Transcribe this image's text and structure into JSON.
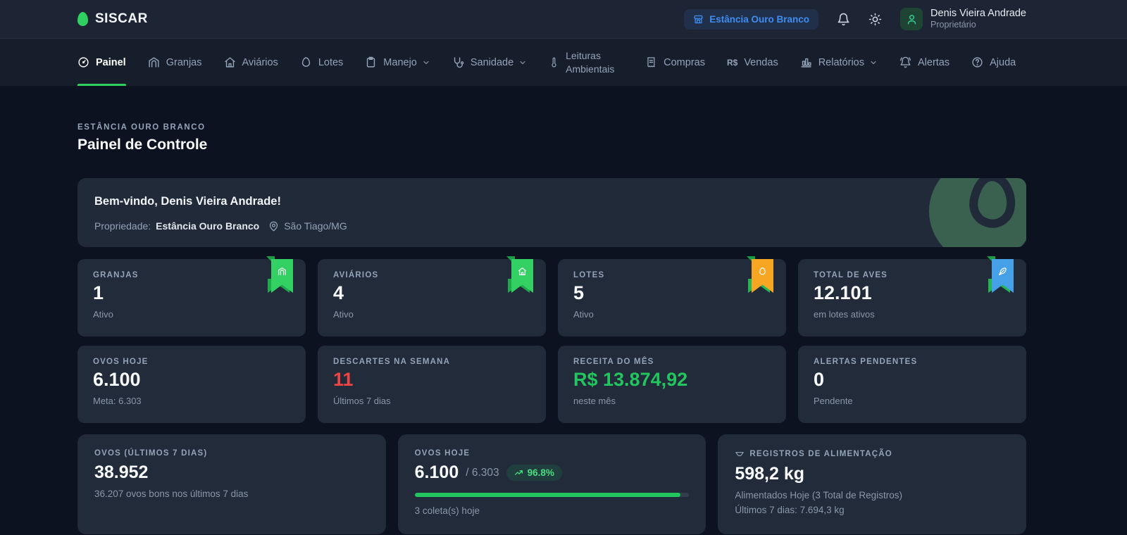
{
  "brand": {
    "name": "SISCAR"
  },
  "topbar": {
    "property_badge": "Estância Ouro Branco",
    "user": {
      "name": "Denis Vieira Andrade",
      "role": "Proprietário"
    }
  },
  "nav": {
    "items": [
      {
        "label": "Painel",
        "icon": "gauge-icon",
        "active": true
      },
      {
        "label": "Granjas",
        "icon": "warehouse-icon"
      },
      {
        "label": "Aviários",
        "icon": "home-icon"
      },
      {
        "label": "Lotes",
        "icon": "egg-icon"
      },
      {
        "label": "Manejo",
        "icon": "clipboard-icon",
        "dropdown": true
      },
      {
        "label": "Sanidade",
        "icon": "stethoscope-icon",
        "dropdown": true
      },
      {
        "label": "Leituras Ambientais",
        "icon": "thermometer-icon"
      },
      {
        "label": "Compras",
        "icon": "receipt-icon"
      },
      {
        "label": "Vendas",
        "icon": "currency-rs-icon"
      },
      {
        "label": "Relatórios",
        "icon": "bar-chart-icon",
        "dropdown": true
      },
      {
        "label": "Alertas",
        "icon": "bell-ring-icon"
      },
      {
        "label": "Ajuda",
        "icon": "help-circle-icon"
      }
    ]
  },
  "page": {
    "eyebrow": "ESTÂNCIA OURO BRANCO",
    "title": "Painel de Controle"
  },
  "welcome": {
    "greeting": "Bem-vindo, Denis Vieira Andrade!",
    "property_label": "Propriedade:",
    "property_name": "Estância Ouro Branco",
    "location": "São Tiago/MG"
  },
  "stats_row1": [
    {
      "label": "GRANJAS",
      "value": "1",
      "sub": "Ativo",
      "ribbon": "green",
      "icon": "warehouse-icon"
    },
    {
      "label": "AVIÁRIOS",
      "value": "4",
      "sub": "Ativo",
      "ribbon": "green",
      "icon": "home-icon"
    },
    {
      "label": "LOTES",
      "value": "5",
      "sub": "Ativo",
      "ribbon": "orange",
      "icon": "egg-icon"
    },
    {
      "label": "TOTAL DE AVES",
      "value": "12.101",
      "sub": "em lotes ativos",
      "ribbon": "blue",
      "icon": "feather-icon"
    }
  ],
  "stats_row2": [
    {
      "label": "OVOS HOJE",
      "value": "6.100",
      "sub": "Meta: 6.303"
    },
    {
      "label": "DESCARTES NA SEMANA",
      "value": "11",
      "sub": "Últimos 7 dias",
      "color": "red"
    },
    {
      "label": "RECEITA DO MÊS",
      "value": "R$ 13.874,92",
      "sub": "neste mês",
      "color": "green"
    },
    {
      "label": "ALERTAS PENDENTES",
      "value": "0",
      "sub": "Pendente"
    }
  ],
  "summary_cards": {
    "eggs7d": {
      "label": "OVOS (ÚLTIMOS 7 DIAS)",
      "value": "38.952",
      "sub": "36.207 ovos bons nos últimos 7 dias"
    },
    "eggs_today": {
      "label": "OVOS HOJE",
      "value": "6.100",
      "target": "/ 6.303",
      "badge": "96.8%",
      "progress_pct": 96.8,
      "sub": "3 coleta(s) hoje"
    },
    "feed": {
      "label": "REGISTROS DE ALIMENTAÇÃO",
      "value": "598,2 kg",
      "sub1": "Alimentados Hoje (3 Total de Registros)",
      "sub2": "Últimos 7 dias: 7.694,3 kg"
    }
  },
  "colors": {
    "accent_green": "#2fd05f",
    "money_green": "#22c55e",
    "alert_red": "#ef4444",
    "badge_blue": "#3f8df1",
    "ribbon_orange": "#f6a623",
    "ribbon_blue": "#46a0e8"
  }
}
